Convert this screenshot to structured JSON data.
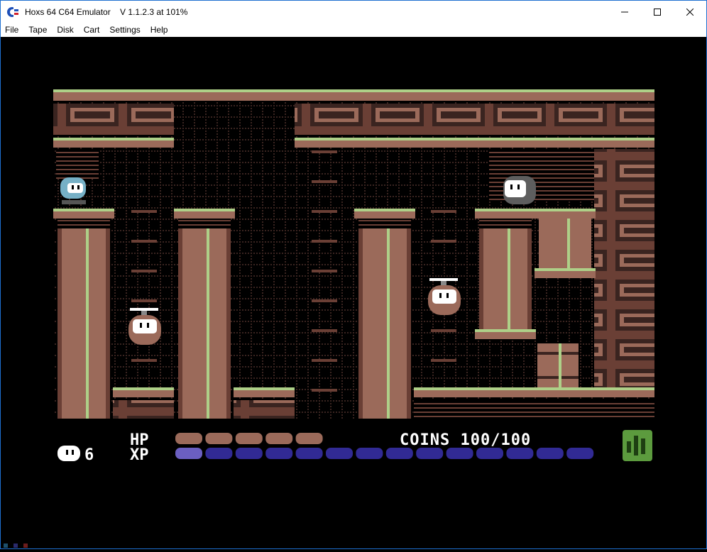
{
  "window": {
    "title": "Hoxs 64 C64 Emulator    V 1.1.2.3 at 101%",
    "icon": "commodore-logo-icon",
    "controls": [
      "minimize-icon",
      "maximize-icon",
      "close-icon"
    ]
  },
  "menu": [
    {
      "label": "File"
    },
    {
      "label": "Tape"
    },
    {
      "label": "Disk"
    },
    {
      "label": "Cart"
    },
    {
      "label": "Settings"
    },
    {
      "label": "Help"
    }
  ],
  "hud": {
    "lives": "6",
    "hp_label": "HP",
    "xp_label": "XP",
    "coins_text": "COINS 100/100",
    "hp_segments": 5,
    "xp_segments": 14,
    "xp_filled": 1,
    "map_icon": "map-icon"
  },
  "colors": {
    "hud_brown": "#9b6a5a",
    "xp_filled": "#6b5fc1",
    "xp_empty": "#312a94",
    "hud_green": "#5c9b3e",
    "ledge_green": "#aed088",
    "wall_brown": "#6a3f35"
  }
}
